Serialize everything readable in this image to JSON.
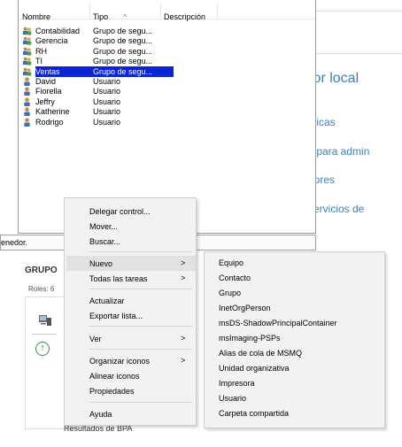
{
  "columns": {
    "name": "Nombre",
    "type": "Tipo",
    "description": "Descripción"
  },
  "rows": [
    {
      "name": "Contabilidad",
      "type": "Grupo de segu...",
      "icon": "group-icon"
    },
    {
      "name": "Gerencia",
      "type": "Grupo de segu...",
      "icon": "group-icon"
    },
    {
      "name": "RH",
      "type": "Grupo de segu...",
      "icon": "group-icon"
    },
    {
      "name": "TI",
      "type": "Grupo de segu...",
      "icon": "group-icon"
    },
    {
      "name": "Ventas",
      "type": "Grupo de segu...",
      "icon": "group-icon",
      "selected": true
    },
    {
      "name": "David",
      "type": "Usuario",
      "icon": "user-icon"
    },
    {
      "name": "Fiorella",
      "type": "Usuario",
      "icon": "user-icon"
    },
    {
      "name": "Jeffry",
      "type": "Usuario",
      "icon": "user-icon"
    },
    {
      "name": "Katherine",
      "type": "Usuario",
      "icon": "user-icon"
    },
    {
      "name": "Rodrigo",
      "type": "Usuario",
      "icon": "user-icon"
    }
  ],
  "status_text": "enedor.",
  "background": {
    "heading": "lor local",
    "link1": "sticas",
    "link2": "s para admin",
    "link3": "dores",
    "link4": "servicios de",
    "group_title": "GRUPO",
    "roles": "Roles: 6",
    "bpa": "Resultados de BPA"
  },
  "menu": {
    "delegate": "Delegar control...",
    "move": "Mover...",
    "find": "Buscar...",
    "new": "Nuevo",
    "all_tasks": "Todas las tareas",
    "refresh": "Actualizar",
    "export": "Exportar lista...",
    "view": "Ver",
    "arrange": "Organizar iconos",
    "align": "Alinear iconos",
    "properties": "Propiedades",
    "help": "Ayuda"
  },
  "submenu": [
    "Equipo",
    "Contacto",
    "Grupo",
    "InetOrgPerson",
    "msDS-ShadowPrincipalContainer",
    "msImaging-PSPs",
    "Alias de cola de MSMQ",
    "Unidad organizativa",
    "Impresora",
    "Usuario",
    "Carpeta compartida"
  ],
  "colors": {
    "selection": "#0a24d6",
    "accent_link": "#3a7fc1",
    "menu_bg": "#f2f2f2"
  }
}
